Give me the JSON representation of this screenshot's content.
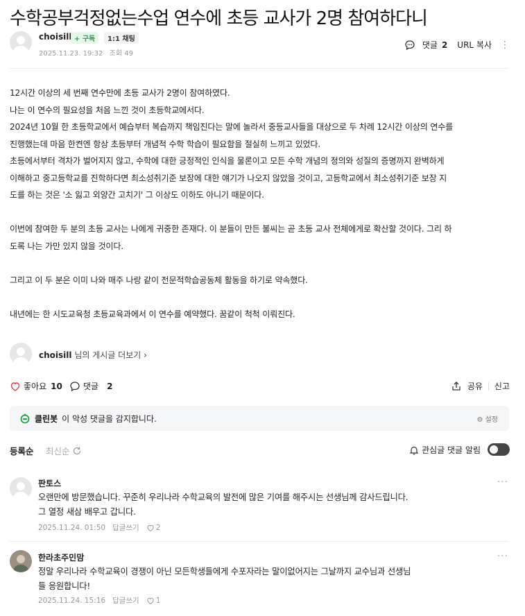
{
  "post": {
    "title": "수학공부걱정없는수업 연수에 초등 교사가 2명 참여하다니",
    "author": "choisill",
    "follow_badge": "+ 구독",
    "chat_badge": "1:1 채팅",
    "date": "2025.11.23. 19:32",
    "views": "조회 49",
    "comment_label": "댓글",
    "comment_count": "2",
    "url_copy": "URL 복사",
    "paragraphs": [
      "12시간 이상의 세 번째 연수만에 초등 교사가 2명이 참여하였다.",
      "나는 이 연수의 필요성을 처음 느낀 것이 초등학교에서다.",
      "2024년 10월 한 초등학교에서 예습부터 복습까지 책임진다는 말에 놀라서 중등교사들을 대상으로 두 차례 12시간 이상의 연수를",
      "진행했는데 마음 한켠엔 항상 초등부터 개념적 수학 학습이 필요함을 절실히 느끼고 있었다.",
      "초등에서부터 격차가 벌어지지 않고, 수학에 대한 긍정적인 인식을 물론이고 모든 수학 개념의 정의와 성질의 증명까지 완벽하게",
      "이해하고 중고등학교를 진학하다면 최소성취기준 보장에 대한 얘기가 나오지 않았을 것이고, 고등학교에서 최소성취기준 보장 지",
      "도를 하는 것은 '소 잃고 외양간 고치기' 그 이상도 이하도 아니기 때문이다.",
      "",
      "이번에 참여한 두 분의 초등 교사는 나에게 귀중한 존재다. 이 분들이 만든 불씨는 곧 초등 교사 전체에게로 확산할 것이다. 그리 하",
      "도록 나는 가만 있지 않을 것이다.",
      "",
      "그리고 이 두 분은 이미 나와 매주 나랑 같이 전문적학습공동체 활동을 하기로 약속했다.",
      "",
      "내년에는 한 시도교육청 초등교육과에서 이 연수를 예약했다. 꿈같이 척척 이뤄진다."
    ],
    "more_author": "choisill",
    "more_suffix": "님의 게시글 더보기 ›",
    "like_label": "좋아요",
    "like_count": "10",
    "comment_label2": "댓글",
    "comment_count2": "2",
    "share_label": "공유",
    "report_label": "신고"
  },
  "cleanbot": {
    "name": "클린봇",
    "text": "이 악성 댓글을 감지합니다.",
    "setting": "설정"
  },
  "comments_header": {
    "sort_registered": "등록순",
    "sort_latest": "최신순",
    "alarm_label": "관심글 댓글 알림"
  },
  "comments": [
    {
      "name": "판토스",
      "lines": [
        "오랜만에 방문했습니다. 꾸준히 우리나라 수학교육의 발전에 많은 기여를 해주시는 선생님께 감사드립니다.",
        "그 열정 새삼 배우고 갑니다."
      ],
      "date": "2025.11.24. 01:50",
      "reply": "답글쓰기",
      "likes": "2"
    },
    {
      "name": "한라초주민맘",
      "lines": [
        "정말 우리나라 수학교육이 경쟁이 아닌 모든학생들에게 수포자라는 말이없어지는 그날까지 교수님과 선생님",
        "들 응원합니다!"
      ],
      "date": "2025.11.24. 15:16",
      "reply": "답글쓰기",
      "likes": "1"
    }
  ],
  "colors": {
    "green": "#1fa34a",
    "like_red": "#e04040"
  }
}
